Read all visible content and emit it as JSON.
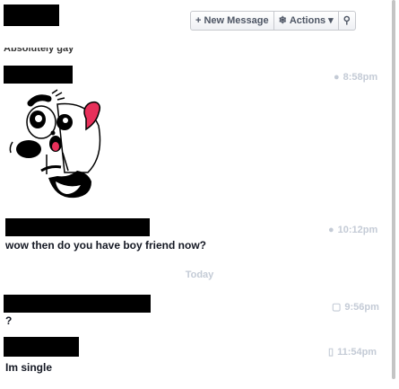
{
  "toolbar": {
    "new_message_label": "New Message",
    "new_message_icon": "+",
    "actions_label": "Actions",
    "actions_icon": "❄",
    "dropdown_icon": "▾",
    "search_icon": "⚲"
  },
  "conversation": {
    "top_partial_text": "Absolutely gay",
    "messages": [
      {
        "time": "8:58pm",
        "body": "",
        "sticker": "panda-sticker"
      },
      {
        "time": "10:12pm",
        "body": "wow then do you have boy friend now?"
      },
      {
        "time": "9:56pm",
        "body": "?"
      },
      {
        "time": "11:54pm",
        "body": "Im single"
      }
    ],
    "day_separator": "Today"
  },
  "colors": {
    "timestamp": "#c4cbd6",
    "message_text": "#141823",
    "toolbar_text": "#4e5665",
    "sticker_accent": "#e8305a"
  }
}
